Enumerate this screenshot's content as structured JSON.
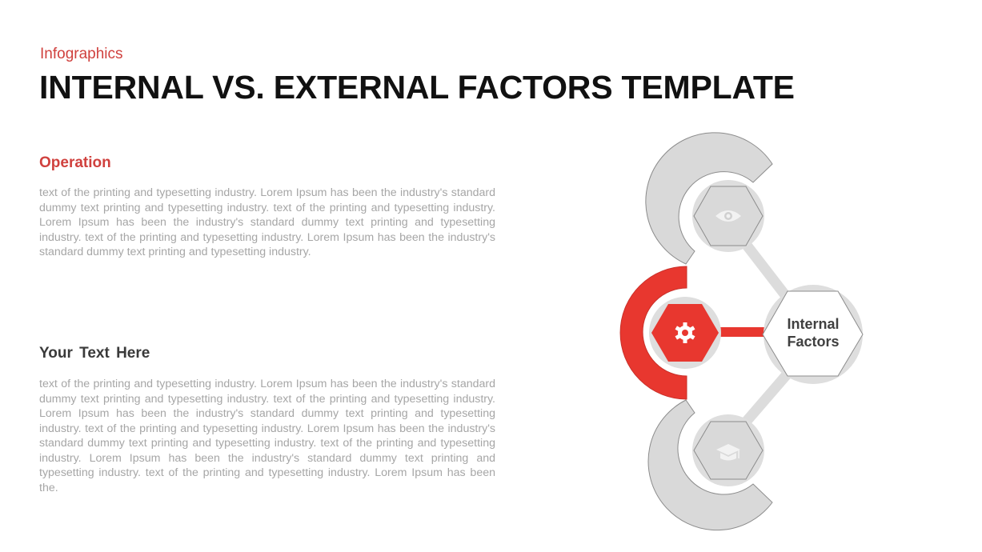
{
  "header": {
    "subtitle": "Infographics",
    "title": "INTERNAL VS. EXTERNAL FACTORS TEMPLATE"
  },
  "sections": [
    {
      "heading": "Operation",
      "body": "text of the printing and typesetting industry. Lorem Ipsum has been the industry's standard dummy text printing and typesetting industry. text of the printing and typesetting industry. Lorem Ipsum has been the industry's standard dummy text printing and typesetting industry. text of the printing and typesetting industry. Lorem Ipsum has been the industry's standard dummy text printing and typesetting industry."
    },
    {
      "heading": "Your  Text Here",
      "body": "text of the printing and typesetting industry. Lorem Ipsum has been the industry's standard dummy text printing and typesetting industry. text of the printing and typesetting industry. Lorem Ipsum has been the industry's standard dummy text printing and typesetting industry. text of the printing and typesetting industry. Lorem Ipsum has been the industry's standard dummy text printing and typesetting industry. text of the printing and typesetting industry. Lorem Ipsum has been the industry's standard dummy text printing and typesetting industry. text of the printing and typesetting industry. Lorem Ipsum has been the."
    }
  ],
  "diagram": {
    "center_label_line1": "Internal",
    "center_label_line2": "Factors",
    "nodes": [
      {
        "icon": "eye-icon",
        "state": "inactive"
      },
      {
        "icon": "gear-icon",
        "state": "active"
      },
      {
        "icon": "graduation-cap-icon",
        "state": "inactive"
      }
    ],
    "colors": {
      "accent": "#e8372f",
      "inactive_fill": "#d9d9d9",
      "outline": "#8c8c8c",
      "icon_light": "#f2f2f2",
      "center_fill": "#ffffff",
      "label": "#404040"
    }
  }
}
